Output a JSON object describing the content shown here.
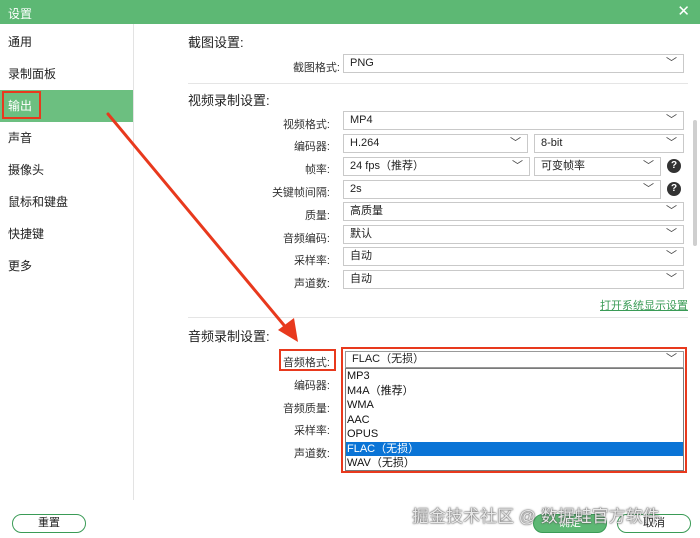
{
  "window": {
    "title": "设置",
    "close_icon": "close-icon"
  },
  "sidebar": {
    "items": [
      {
        "label": "通用"
      },
      {
        "label": "录制面板"
      },
      {
        "label": "输出"
      },
      {
        "label": "声音"
      },
      {
        "label": "摄像头"
      },
      {
        "label": "鼠标和键盘"
      },
      {
        "label": "快捷键"
      },
      {
        "label": "更多"
      }
    ],
    "active": "输出"
  },
  "screenshot_settings": {
    "heading": "截图设置:",
    "format_label": "截图格式:",
    "format_value": "PNG"
  },
  "video_settings": {
    "heading": "视频录制设置:",
    "format_label": "视频格式:",
    "format_value": "MP4",
    "encoder_label": "编码器:",
    "encoder_value": "H.264",
    "bitdepth_value": "8-bit",
    "framerate_label": "帧率:",
    "framerate_value": "24 fps（推荐）",
    "framerate_mode_value": "可变帧率",
    "keyframe_label": "关键帧间隔:",
    "keyframe_value": "2s",
    "quality_label": "质量:",
    "quality_value": "高质量",
    "audio_encoder_label": "音频编码:",
    "audio_encoder_value": "默认",
    "samplerate_label": "采样率:",
    "samplerate_value": "自动",
    "channels_label": "声道数:",
    "channels_value": "自动",
    "display_settings_link": "打开系统显示设置"
  },
  "audio_settings": {
    "heading": "音频录制设置:",
    "format_label": "音频格式:",
    "format_value": "FLAC（无损）",
    "encoder_label": "编码器:",
    "quality_label": "音频质量:",
    "samplerate_label": "采样率:",
    "channels_label": "声道数:",
    "format_options": [
      "MP3",
      "M4A（推荐）",
      "WMA",
      "AAC",
      "OPUS",
      "FLAC（无损）",
      "WAV（无损）"
    ],
    "selected_option": "FLAC（无损）"
  },
  "footer": {
    "reset_label": "重置",
    "ok_label": "确定",
    "cancel_label": "取消"
  },
  "watermark": "掘金技术社区 @ 数据蛙官方软件",
  "colors": {
    "accent": "#5db874",
    "highlight": "#e8391d",
    "selected": "#0a74d6",
    "link": "#3a9b56"
  }
}
